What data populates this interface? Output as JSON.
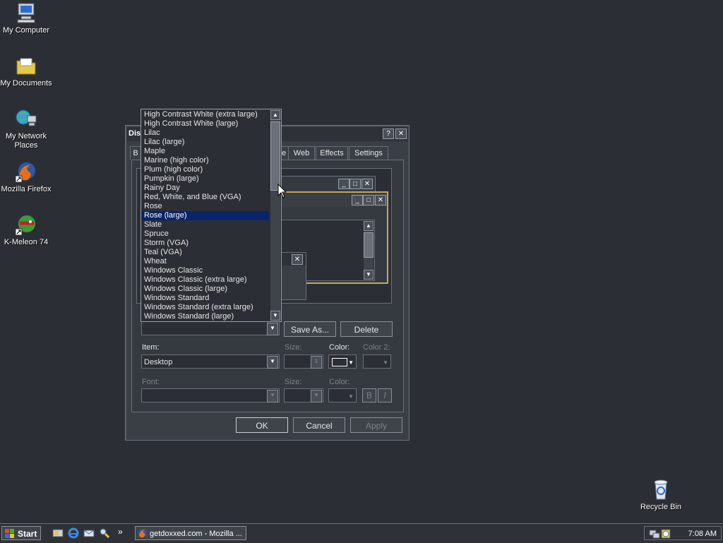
{
  "desktop": {
    "icons": [
      {
        "label": "My Computer"
      },
      {
        "label": "My Documents"
      },
      {
        "label": "My Network Places"
      },
      {
        "label": "Mozilla Firefox"
      },
      {
        "label": "K-Meleon 74"
      },
      {
        "label": "Recycle Bin"
      }
    ]
  },
  "window": {
    "title_partial": "Disp",
    "tabs": [
      {
        "label": "B"
      },
      {
        "label": "e"
      },
      {
        "label": "Web"
      },
      {
        "label": "Effects"
      },
      {
        "label": "Settings"
      }
    ],
    "buttons": {
      "save_as": "Save As...",
      "delete": "Delete",
      "ok": "OK",
      "cancel": "Cancel",
      "apply": "Apply"
    },
    "item_label": "Item:",
    "item_value": "Desktop",
    "size_label": "Size:",
    "color_label": "Color:",
    "color2_label": "Color 2:",
    "font_label": "Font:",
    "size2_label": "Size:",
    "color3_label": "Color:",
    "bold_label": "B",
    "italic_label": "I",
    "accent_color": "#0a246a"
  },
  "scheme_list": {
    "items": [
      "High Contrast White (extra large)",
      "High Contrast White (large)",
      "Lilac",
      "Lilac (large)",
      "Maple",
      "Marine (high color)",
      "Plum (high color)",
      "Pumpkin (large)",
      "Rainy Day",
      "Red, White, and Blue (VGA)",
      "Rose",
      "Rose (large)",
      "Slate",
      "Spruce",
      "Storm (VGA)",
      "Teal (VGA)",
      "Wheat",
      "Windows Classic",
      "Windows Classic (extra large)",
      "Windows Classic (large)",
      "Windows Standard",
      "Windows Standard (extra large)",
      "Windows Standard (large)"
    ],
    "selected": "Rose (large)"
  },
  "taskbar": {
    "start_label": "Start",
    "task_label": "getdoxxed.com - Mozilla ...",
    "chevron": "»",
    "clock": "7:08 AM"
  }
}
